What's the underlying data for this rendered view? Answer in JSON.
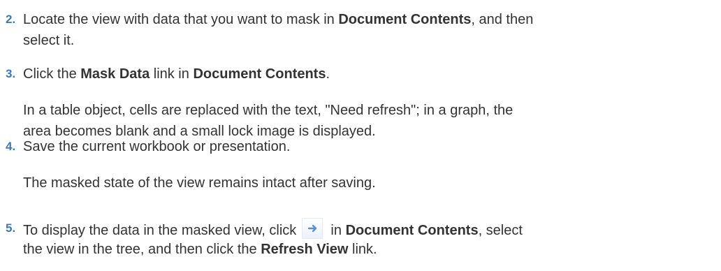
{
  "steps": [
    {
      "number": "2.",
      "lines": [
        {
          "t1": "Locate the view with data that you want to mask in ",
          "b1": "Document Contents",
          "t2": ", and then"
        },
        {
          "t1": "select it."
        }
      ]
    },
    {
      "number": "3.",
      "lines": [
        {
          "t1": "Click the ",
          "b1": "Mask Data",
          "t2": " link in ",
          "b2": "Document Contents",
          "t3": "."
        }
      ],
      "paragraph": [
        "In a table object, cells are replaced with the text, \"Need refresh\"; in a graph, the",
        "area becomes blank and a small lock image is displayed."
      ]
    },
    {
      "number": "4.",
      "lines": [
        {
          "t1": "Save the current workbook or presentation."
        }
      ],
      "paragraph": [
        "The masked state of the view remains intact after saving."
      ]
    },
    {
      "number": "5.",
      "lines": [
        {
          "t1": "To display the data in the masked view, click ",
          "icon": "right-arrow-icon",
          "t2": " in ",
          "b1": "Document Contents",
          "t3": ", select"
        },
        {
          "t1": "the view in the tree, and then click the ",
          "b1": "Refresh View",
          "t2": " link."
        }
      ]
    }
  ],
  "colors": {
    "step_number": "#3a7ab8",
    "text": "#333333",
    "icon_arrow": "#5a8fd0"
  }
}
